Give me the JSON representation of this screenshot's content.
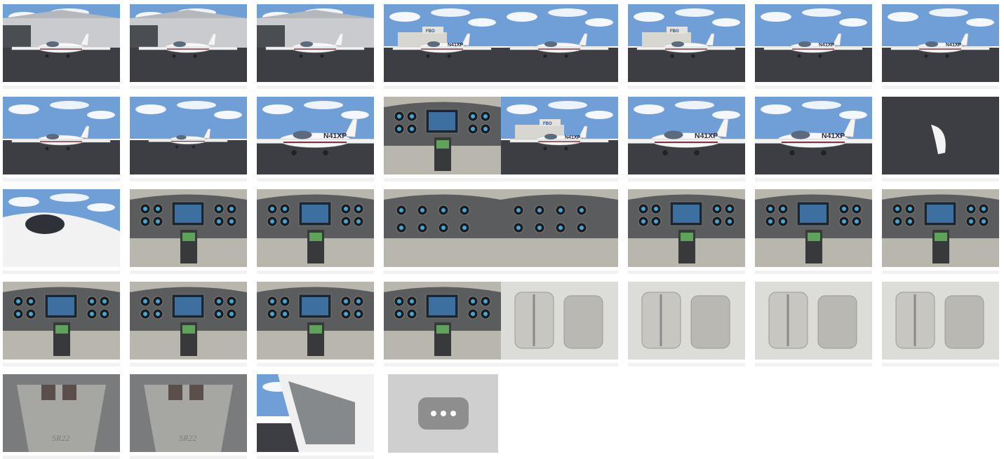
{
  "gallery": {
    "photos": [
      {
        "kind": "exterior-hangar",
        "tail": ""
      },
      {
        "kind": "exterior-hangar",
        "tail": ""
      },
      {
        "kind": "exterior-hangar-side",
        "tail": ""
      },
      {
        "kind": "exterior-fbo",
        "tail": "N41XP"
      },
      {
        "kind": "exterior-tail",
        "tail": ""
      },
      {
        "kind": "exterior-fbo-front",
        "tail": ""
      },
      {
        "kind": "exterior-side",
        "tail": "N41XP"
      },
      {
        "kind": "exterior-side",
        "tail": "N41XP"
      },
      {
        "kind": "exterior-front",
        "tail": ""
      },
      {
        "kind": "exterior-front-far",
        "tail": ""
      },
      {
        "kind": "exterior-side-close",
        "tail": "N41XP"
      },
      {
        "kind": "cockpit-panel",
        "tail": ""
      },
      {
        "kind": "exterior-tail-fbo",
        "tail": "N41XP"
      },
      {
        "kind": "exterior-tail-close",
        "tail": "N41XP"
      },
      {
        "kind": "exterior-side-close",
        "tail": "N41XP"
      },
      {
        "kind": "exterior-ground-detail",
        "tail": ""
      },
      {
        "kind": "exterior-cockpit-side",
        "tail": ""
      },
      {
        "kind": "cockpit-panel",
        "tail": ""
      },
      {
        "kind": "cockpit-panel",
        "tail": ""
      },
      {
        "kind": "cockpit-gauges",
        "tail": ""
      },
      {
        "kind": "cockpit-gauges",
        "tail": ""
      },
      {
        "kind": "cockpit-console",
        "tail": ""
      },
      {
        "kind": "cockpit-console",
        "tail": ""
      },
      {
        "kind": "cockpit-side",
        "tail": ""
      },
      {
        "kind": "cockpit-panel",
        "tail": ""
      },
      {
        "kind": "cockpit-panel",
        "tail": ""
      },
      {
        "kind": "cockpit-wide",
        "tail": ""
      },
      {
        "kind": "cockpit-ceiling",
        "tail": ""
      },
      {
        "kind": "interior-cabin",
        "tail": ""
      },
      {
        "kind": "interior-seats",
        "tail": ""
      },
      {
        "kind": "interior-seats",
        "tail": ""
      },
      {
        "kind": "interior-seats",
        "tail": ""
      },
      {
        "kind": "interior-cargo",
        "tail": ""
      },
      {
        "kind": "interior-cargo",
        "tail": ""
      },
      {
        "kind": "exterior-door",
        "tail": ""
      }
    ],
    "more_button": {
      "icon": "ellipsis-icon"
    }
  }
}
